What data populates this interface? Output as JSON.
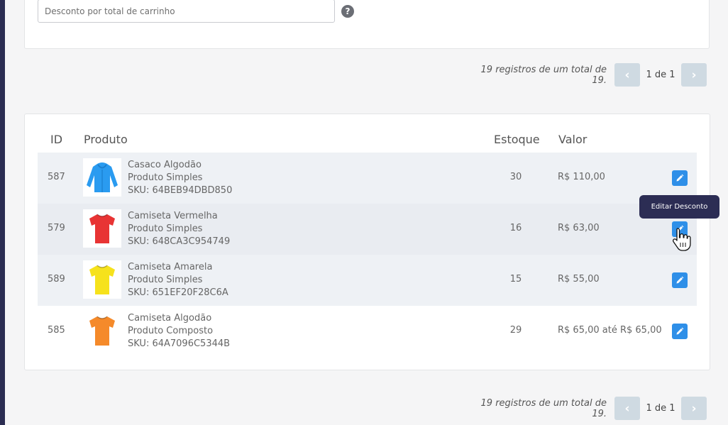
{
  "filter": {
    "placeholder": "Desconto por total de carrinho",
    "help_glyph": "?"
  },
  "pagination": {
    "summary": "19 registros de um total de 19.",
    "page_label": "1 de 1",
    "prev_glyph": "‹",
    "next_glyph": "›"
  },
  "table": {
    "headers": {
      "id": "ID",
      "product": "Produto",
      "stock": "Estoque",
      "value": "Valor"
    },
    "rows": [
      {
        "id": "587",
        "name": "Casaco Algodão",
        "type": "Produto Simples",
        "sku": "SKU: 64BEB94DBD850",
        "stock": "30",
        "value": "R$ 110,00",
        "thumb_color": "#2a9bf0",
        "thumb_icon": "hoodie-icon"
      },
      {
        "id": "579",
        "name": "Camiseta Vermelha",
        "type": "Produto Simples",
        "sku": "SKU: 648CA3C954749",
        "stock": "16",
        "value": "R$ 63,00",
        "thumb_color": "#e83434",
        "thumb_icon": "tshirt-icon"
      },
      {
        "id": "589",
        "name": "Camiseta Amarela",
        "type": "Produto Simples",
        "sku": "SKU: 651EF20F28C6A",
        "stock": "15",
        "value": "R$ 55,00",
        "thumb_color": "#f6e21c",
        "thumb_icon": "tshirt-icon"
      },
      {
        "id": "585",
        "name": "Camiseta Algodão",
        "type": "Produto Composto",
        "sku": "SKU: 64A7096C5344B",
        "stock": "29",
        "value": "R$ 65,00 até R$ 65,00",
        "thumb_color": "#f58a2a",
        "thumb_icon": "tshirt-icon"
      }
    ]
  },
  "tooltip": {
    "text": "Editar Desconto"
  },
  "colors": {
    "accent": "#2e8fe8",
    "sidebar": "#2b2d52",
    "tooltip_bg": "#2c2d54",
    "pager_btn": "#cfdae2"
  }
}
